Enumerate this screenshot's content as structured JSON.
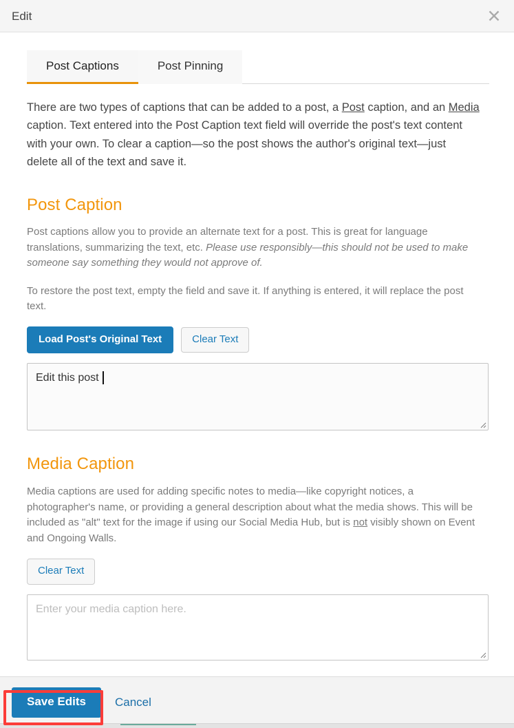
{
  "header": {
    "title": "Edit",
    "close_icon": "close-icon"
  },
  "tabs": [
    {
      "label": "Post Captions",
      "active": true
    },
    {
      "label": "Post Pinning",
      "active": false
    }
  ],
  "intro": {
    "part1": "There are two types of captions that can be added to a post, a ",
    "link1": "Post",
    "part2": " caption, and an ",
    "link2": "Media",
    "part3": " caption. Text entered into the Post Caption text field will override the post's text content with your own. To clear a caption—so the post shows the author's original text—just delete all of the text and save it."
  },
  "post_caption": {
    "title": "Post Caption",
    "desc_normal": "Post captions allow you to provide an alternate text for a post. This is great for language translations, summarizing the text, etc. ",
    "desc_italic": "Please use responsibly—this should not be used to make someone say something they would not approve of.",
    "desc2": "To restore the post text, empty the field and save it. If anything is entered, it will replace the post text.",
    "load_button": "Load Post's Original Text",
    "clear_button": "Clear Text",
    "textarea_value": "Edit this post",
    "textarea_placeholder": ""
  },
  "media_caption": {
    "title": "Media Caption",
    "desc_part1": "Media captions are used for adding specific notes to media—like copyright notices, a photographer's name, or providing a general description about what the media shows. This will be included as \"alt\" text for the image if using our Social Media Hub, but is ",
    "desc_underline": "not",
    "desc_part2": " visibly shown on Event and Ongoing Walls.",
    "clear_button": "Clear Text",
    "textarea_value": "",
    "textarea_placeholder": "Enter your media caption here."
  },
  "footer": {
    "save_label": "Save Edits",
    "cancel_label": "Cancel"
  },
  "colors": {
    "accent_orange": "#f2960d",
    "primary_blue": "#1b7cb8",
    "highlight_red": "#fc3d39",
    "tab_underline": "#e8920a"
  }
}
